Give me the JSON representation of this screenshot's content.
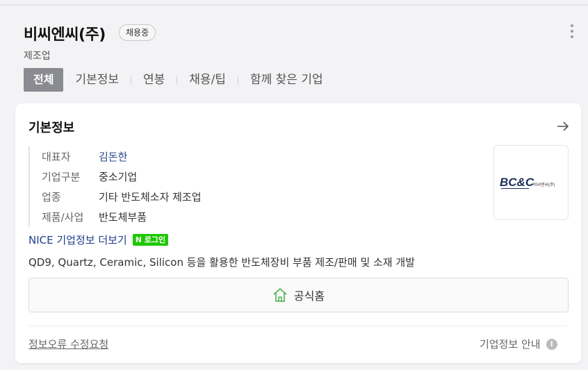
{
  "company": {
    "name": "비씨엔씨(주)",
    "badge": "채용중",
    "industry": "제조업"
  },
  "tabs": [
    {
      "label": "전체",
      "active": true
    },
    {
      "label": "기본정보"
    },
    {
      "label": "연봉"
    },
    {
      "label": "채용/팁"
    },
    {
      "label": "함께 찾은 기업"
    }
  ],
  "card": {
    "title": "기본정보",
    "rows": [
      {
        "key": "대표자",
        "value": "김돈한"
      },
      {
        "key": "기업구분",
        "value": "중소기업"
      },
      {
        "key": "업종",
        "value": "기타 반도체소자 제조업"
      },
      {
        "key": "제품/사업",
        "value": "반도체부품"
      }
    ],
    "logo_text": "BC&C",
    "logo_subtext": "비씨엔씨(주)",
    "nice_link": "NICE 기업정보 더보기",
    "login_badge": "로그인",
    "login_badge_n": "N",
    "description": "QD9, Quartz, Ceramic, Silicon 등을 활용한 반도체장비 부품 제조/판매 및 소재 개발",
    "home_button": "공식홈",
    "report_link": "정보오류 수정요청",
    "guide_label": "기업정보 안내",
    "guide_icon": "i"
  },
  "colors": {
    "active_tab": "#8a8b90",
    "link": "#1f3e8a",
    "naver_green": "#1ec800",
    "home_icon": "#4caf50"
  }
}
